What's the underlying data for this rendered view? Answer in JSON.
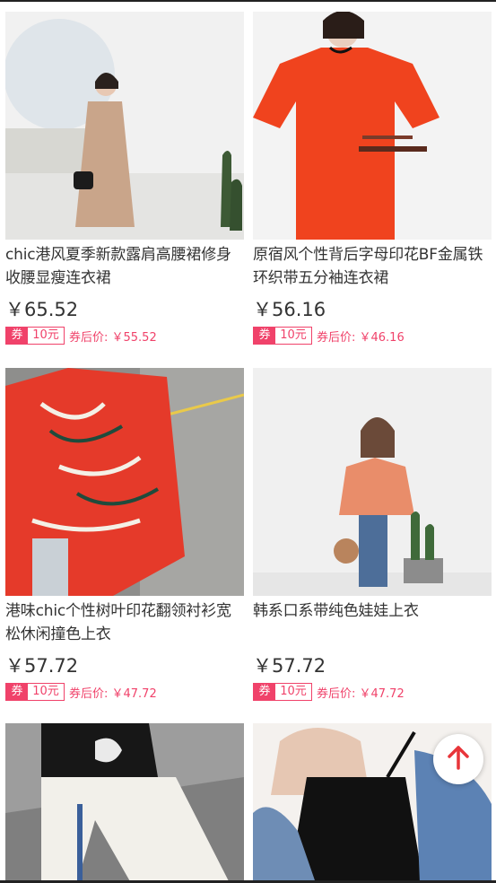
{
  "products": [
    {
      "title": "chic港风夏季新款露肩高腰裙修身收腰显瘦连衣裙",
      "price": "￥65.52",
      "coupon_tag": "券",
      "coupon_amount": "10元",
      "after_price": "券后价: ￥55.52"
    },
    {
      "title": "原宿风个性背后字母印花BF金属铁环织带五分袖连衣裙",
      "price": "￥56.16",
      "coupon_tag": "券",
      "coupon_amount": "10元",
      "after_price": "券后价: ￥46.16"
    },
    {
      "title": "港味chic个性树叶印花翻领衬衫宽松休闲撞色上衣",
      "price": "￥57.72",
      "coupon_tag": "券",
      "coupon_amount": "10元",
      "after_price": "券后价: ￥47.72"
    },
    {
      "title": "韩系口系带纯色娃娃上衣",
      "price": "￥57.72",
      "coupon_tag": "券",
      "coupon_amount": "10元",
      "after_price": "券后价: ￥47.72"
    },
    {
      "title": "",
      "price": "",
      "coupon_tag": "",
      "coupon_amount": "",
      "after_price": ""
    },
    {
      "title": "",
      "price": "",
      "coupon_tag": "",
      "coupon_amount": "",
      "after_price": ""
    }
  ],
  "colors": {
    "accent": "#f0426a",
    "text": "#333333"
  },
  "icons": {
    "back_to_top": "arrow-up-icon"
  }
}
